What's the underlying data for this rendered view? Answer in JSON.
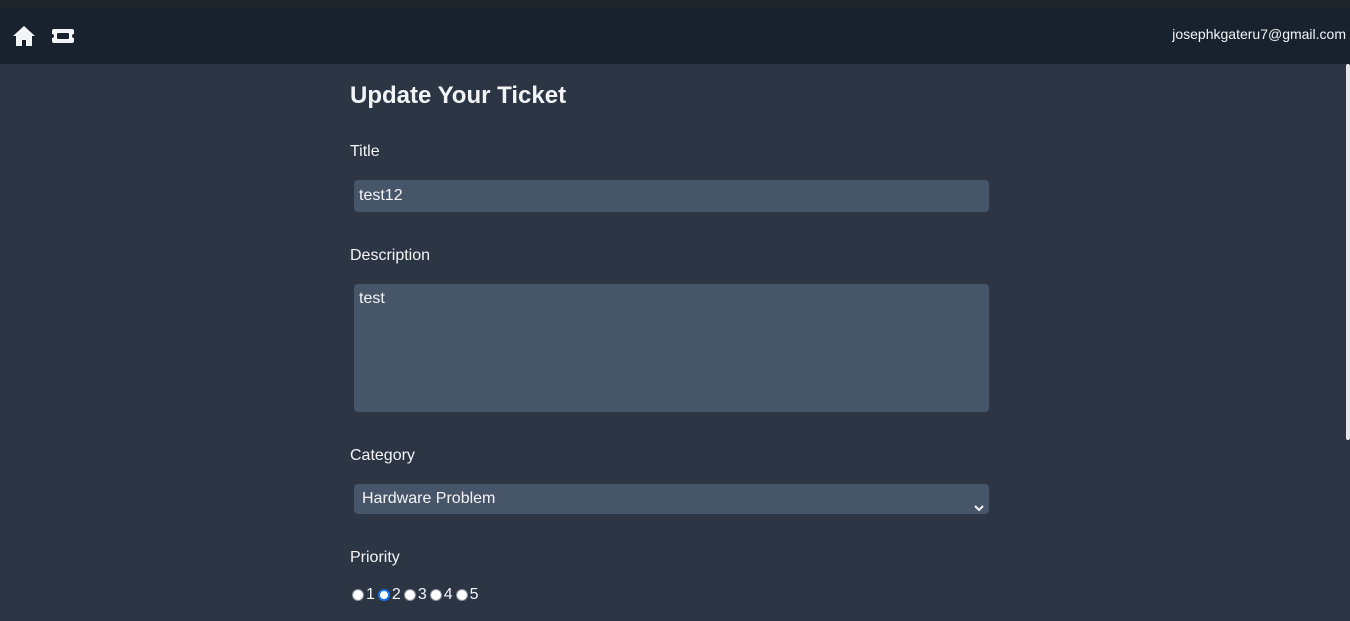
{
  "navbar": {
    "home_icon": "home-icon",
    "ticket_icon": "ticket-icon",
    "user_email": "josephkgateru7@gmail.com"
  },
  "form": {
    "title": "Update Your Ticket",
    "title_label": "Title",
    "title_value": "test12",
    "description_label": "Description",
    "description_value": "test",
    "category_label": "Category",
    "category_selected": "Hardware Problem",
    "priority_label": "Priority",
    "priority_options": [
      "1",
      "2",
      "3",
      "4",
      "5"
    ],
    "priority_selected": "2"
  },
  "colors": {
    "background": "#2b3544",
    "navbar": "#18222f",
    "input": "#475569",
    "radio_checked": "#1a73e8"
  }
}
